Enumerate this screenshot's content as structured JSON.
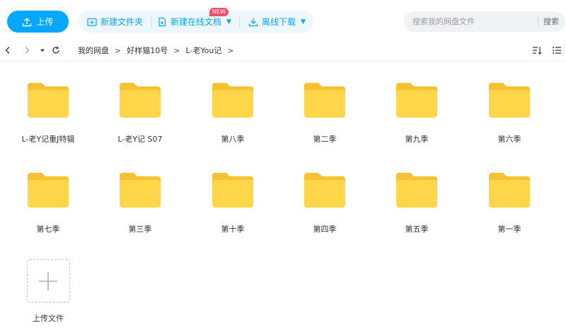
{
  "toolbar": {
    "upload_label": "上传",
    "new_folder_label": "新建文件夹",
    "new_doc_label": "新建在线文档",
    "new_badge": "NEW",
    "offline_download_label": "离线下载",
    "search_placeholder": "搜索我的网盘文件",
    "search_button": "搜索"
  },
  "nav": {
    "breadcrumbs": [
      "我的网盘",
      "好样猫10号",
      "L-老You记"
    ]
  },
  "folders": [
    {
      "name": "L-老Y记重J特辑"
    },
    {
      "name": "L-老Y记 S07"
    },
    {
      "name": "第八季"
    },
    {
      "name": "第二季"
    },
    {
      "name": "第九季"
    },
    {
      "name": "第六季"
    },
    {
      "name": "第七季"
    },
    {
      "name": "第三季"
    },
    {
      "name": "第十季"
    },
    {
      "name": "第四季"
    },
    {
      "name": "第五季"
    },
    {
      "name": "第一季"
    }
  ],
  "upload_tile": {
    "label": "上传文件"
  },
  "colors": {
    "accent": "#06a7ff",
    "folder_body": "#ffd54a",
    "folder_tab": "#f7c22f",
    "badge": "#f64e6f"
  }
}
